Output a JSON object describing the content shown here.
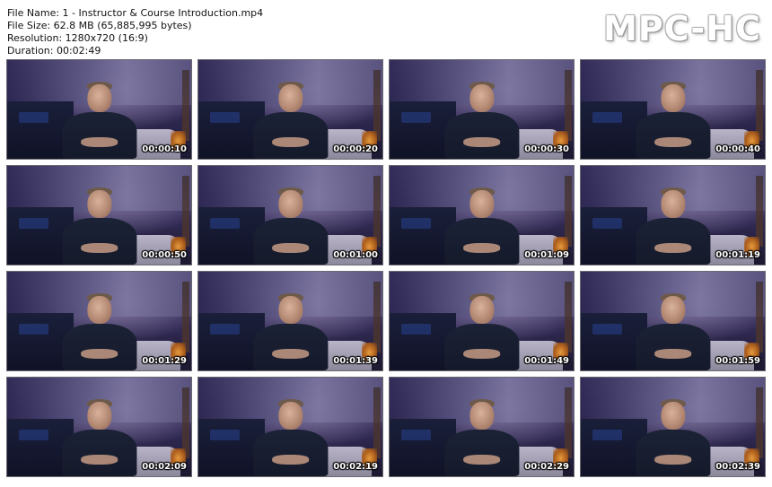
{
  "info": {
    "file_name": "File Name: 1 - Instructor & Course Introduction.mp4",
    "file_size": "File Size: 62.8 MB (65,885,995 bytes)",
    "resolution": "Resolution: 1280x720 (16:9)",
    "duration": "Duration: 00:02:49"
  },
  "logo": "MPC-HC",
  "thumbnails": [
    {
      "timestamp": "00:00:10"
    },
    {
      "timestamp": "00:00:20"
    },
    {
      "timestamp": "00:00:30"
    },
    {
      "timestamp": "00:00:40"
    },
    {
      "timestamp": "00:00:50"
    },
    {
      "timestamp": "00:01:00"
    },
    {
      "timestamp": "00:01:09"
    },
    {
      "timestamp": "00:01:19"
    },
    {
      "timestamp": "00:01:29"
    },
    {
      "timestamp": "00:01:39"
    },
    {
      "timestamp": "00:01:49"
    },
    {
      "timestamp": "00:01:59"
    },
    {
      "timestamp": "00:02:09"
    },
    {
      "timestamp": "00:02:19"
    },
    {
      "timestamp": "00:02:29"
    },
    {
      "timestamp": "00:02:39"
    }
  ],
  "colors": {
    "background": "#ffffff",
    "text": "#111111",
    "timestamp": "#ffffff"
  }
}
